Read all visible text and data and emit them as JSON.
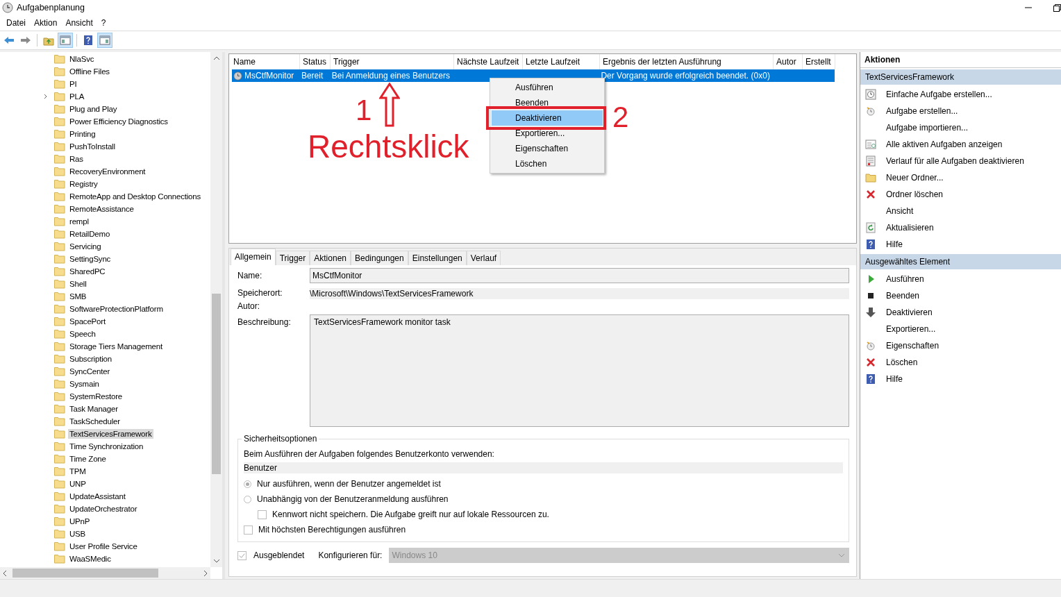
{
  "window": {
    "title": "Aufgabenplanung"
  },
  "menu": [
    "Datei",
    "Aktion",
    "Ansicht",
    "?"
  ],
  "toolbar": [
    {
      "kind": "back",
      "pressed": false
    },
    {
      "kind": "forward",
      "pressed": false
    },
    {
      "kind": "sep"
    },
    {
      "kind": "folder-up",
      "pressed": false
    },
    {
      "kind": "pane-left",
      "pressed": true
    },
    {
      "kind": "sep"
    },
    {
      "kind": "help",
      "pressed": false
    },
    {
      "kind": "pane-right",
      "pressed": true
    }
  ],
  "tree": [
    {
      "label": "NlaSvc",
      "expandable": false,
      "selected": false
    },
    {
      "label": "Offline Files",
      "expandable": false,
      "selected": false
    },
    {
      "label": "PI",
      "expandable": false,
      "selected": false
    },
    {
      "label": "PLA",
      "expandable": true,
      "selected": false
    },
    {
      "label": "Plug and Play",
      "expandable": false,
      "selected": false
    },
    {
      "label": "Power Efficiency Diagnostics",
      "expandable": false,
      "selected": false
    },
    {
      "label": "Printing",
      "expandable": false,
      "selected": false
    },
    {
      "label": "PushToInstall",
      "expandable": false,
      "selected": false
    },
    {
      "label": "Ras",
      "expandable": false,
      "selected": false
    },
    {
      "label": "RecoveryEnvironment",
      "expandable": false,
      "selected": false
    },
    {
      "label": "Registry",
      "expandable": false,
      "selected": false
    },
    {
      "label": "RemoteApp and Desktop Connections",
      "expandable": false,
      "selected": false
    },
    {
      "label": "RemoteAssistance",
      "expandable": false,
      "selected": false
    },
    {
      "label": "rempl",
      "expandable": false,
      "selected": false
    },
    {
      "label": "RetailDemo",
      "expandable": false,
      "selected": false
    },
    {
      "label": "Servicing",
      "expandable": false,
      "selected": false
    },
    {
      "label": "SettingSync",
      "expandable": false,
      "selected": false
    },
    {
      "label": "SharedPC",
      "expandable": false,
      "selected": false
    },
    {
      "label": "Shell",
      "expandable": false,
      "selected": false
    },
    {
      "label": "SMB",
      "expandable": false,
      "selected": false
    },
    {
      "label": "SoftwareProtectionPlatform",
      "expandable": false,
      "selected": false
    },
    {
      "label": "SpacePort",
      "expandable": false,
      "selected": false
    },
    {
      "label": "Speech",
      "expandable": false,
      "selected": false
    },
    {
      "label": "Storage Tiers Management",
      "expandable": false,
      "selected": false
    },
    {
      "label": "Subscription",
      "expandable": false,
      "selected": false
    },
    {
      "label": "SyncCenter",
      "expandable": false,
      "selected": false
    },
    {
      "label": "Sysmain",
      "expandable": false,
      "selected": false
    },
    {
      "label": "SystemRestore",
      "expandable": false,
      "selected": false
    },
    {
      "label": "Task Manager",
      "expandable": false,
      "selected": false
    },
    {
      "label": "TaskScheduler",
      "expandable": false,
      "selected": false
    },
    {
      "label": "TextServicesFramework",
      "expandable": false,
      "selected": true
    },
    {
      "label": "Time Synchronization",
      "expandable": false,
      "selected": false
    },
    {
      "label": "Time Zone",
      "expandable": false,
      "selected": false
    },
    {
      "label": "TPM",
      "expandable": false,
      "selected": false
    },
    {
      "label": "UNP",
      "expandable": false,
      "selected": false
    },
    {
      "label": "UpdateAssistant",
      "expandable": false,
      "selected": false
    },
    {
      "label": "UpdateOrchestrator",
      "expandable": false,
      "selected": false
    },
    {
      "label": "UPnP",
      "expandable": false,
      "selected": false
    },
    {
      "label": "USB",
      "expandable": false,
      "selected": false
    },
    {
      "label": "User Profile Service",
      "expandable": false,
      "selected": false
    },
    {
      "label": "WaaSMedic",
      "expandable": false,
      "selected": false
    }
  ],
  "task_table": {
    "columns": [
      "Name",
      "Status",
      "Trigger",
      "Nächste Laufzeit",
      "Letzte Laufzeit",
      "Ergebnis der letzten Ausführung",
      "Autor",
      "Erstellt"
    ],
    "rows": [
      {
        "selected": true,
        "cells": [
          "MsCtfMonitor",
          "Bereit",
          "Bei Anmeldung eines Benutzers",
          null,
          null,
          "Der Vorgang wurde erfolgreich beendet. (0x0)",
          null,
          null
        ]
      }
    ]
  },
  "context_menu": [
    {
      "label": "Ausführen",
      "selected": false
    },
    {
      "label": "Beenden",
      "selected": false
    },
    {
      "label": "Deaktivieren",
      "selected": true
    },
    {
      "label": "Exportieren...",
      "selected": false
    },
    {
      "label": "Eigenschaften",
      "selected": false
    },
    {
      "label": "Löschen",
      "selected": false
    }
  ],
  "annotations": {
    "step_1": "1",
    "label": "Rechtsklick",
    "step_2": "2"
  },
  "detail": {
    "tabs": [
      {
        "label": "Allgemein",
        "selected": true
      },
      {
        "label": "Trigger",
        "selected": false
      },
      {
        "label": "Aktionen",
        "selected": false
      },
      {
        "label": "Bedingungen",
        "selected": false
      },
      {
        "label": "Einstellungen",
        "selected": false
      },
      {
        "label": "Verlauf",
        "selected": false
      }
    ],
    "fields": [
      {
        "kind": "input",
        "label": "Name:",
        "value": "MsCtfMonitor"
      },
      {
        "kind": "readonly",
        "label": "Speicherort:",
        "value": "\\Microsoft\\Windows\\TextServicesFramework"
      },
      {
        "kind": "plain",
        "label": "Autor:"
      },
      {
        "kind": "textarea",
        "label": "Beschreibung:",
        "value": "TextServicesFramework monitor task"
      }
    ],
    "security": {
      "title": "Sicherheitsoptionen",
      "account_prompt": "Beim Ausführen der Aufgaben folgendes Benutzerkonto verwenden:",
      "account": "Benutzer",
      "options": [
        {
          "kind": "radio",
          "label": "Nur ausführen, wenn der Benutzer angemeldet ist",
          "checked": true
        },
        {
          "kind": "radio",
          "label": "Unabhängig von der Benutzeranmeldung ausführen",
          "checked": false
        },
        {
          "kind": "sub-checkbox",
          "label": "Kennwort nicht speichern. Die Aufgabe greift nur auf lokale Ressourcen zu.",
          "checked": false
        },
        {
          "kind": "checkbox",
          "label": "Mit höchsten Berechtigungen ausführen",
          "checked": false
        }
      ]
    },
    "hidden": {
      "label": "Ausgeblendet",
      "checked": true
    },
    "configure": {
      "label": "Konfigurieren für:",
      "value": "Windows 10"
    }
  },
  "actions": {
    "title": "Aktionen",
    "sections": [
      {
        "title": "TextServicesFramework",
        "items": [
          {
            "label": "Einfache Aufgabe erstellen...",
            "kind": "clock-doc"
          },
          {
            "label": "Aufgabe erstellen...",
            "kind": "clock"
          },
          {
            "label": "Aufgabe importieren...",
            "kind": "plain"
          },
          {
            "label": "Alle aktiven Aufgaben anzeigen",
            "kind": "list"
          },
          {
            "label": "Verlauf für alle Aufgaben deaktivieren",
            "kind": "doc"
          },
          {
            "label": "Neuer Ordner...",
            "kind": "folder"
          },
          {
            "label": "Ordner löschen",
            "kind": "x"
          },
          {
            "label": "Ansicht",
            "kind": "plain"
          },
          {
            "label": "Aktualisieren",
            "kind": "refresh"
          },
          {
            "label": "Hilfe",
            "kind": "help"
          }
        ]
      },
      {
        "title": "Ausgewähltes Element",
        "items": [
          {
            "label": "Ausführen",
            "kind": "play"
          },
          {
            "label": "Beenden",
            "kind": "stop"
          },
          {
            "label": "Deaktivieren",
            "kind": "down"
          },
          {
            "label": "Exportieren...",
            "kind": "plain"
          },
          {
            "label": "Eigenschaften",
            "kind": "clock"
          },
          {
            "label": "Löschen",
            "kind": "x"
          },
          {
            "label": "Hilfe",
            "kind": "help"
          }
        ]
      }
    ]
  }
}
